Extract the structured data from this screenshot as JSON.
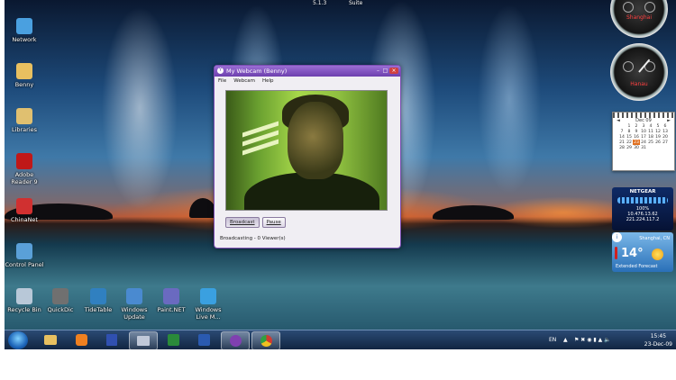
{
  "top_labels": [
    "5.1.3",
    "Suite"
  ],
  "desktop_icons": [
    {
      "label": "Network",
      "color": "#4aa0e0",
      "icon": "network-icon"
    },
    {
      "label": "Benny",
      "color": "#e8c060",
      "icon": "user-folder-icon"
    },
    {
      "label": "Libraries",
      "color": "#e0c070",
      "icon": "libraries-icon"
    },
    {
      "label": "Adobe Reader 9",
      "color": "#c01818",
      "icon": "adobe-reader-icon"
    },
    {
      "label": "ChinaNet",
      "color": "#d03030",
      "icon": "chinanet-icon"
    },
    {
      "label": "Control Panel",
      "color": "#5aa0d8",
      "icon": "control-panel-icon"
    },
    {
      "label": "Recycle Bin",
      "color": "#b8c8d8",
      "icon": "recycle-bin-icon"
    },
    {
      "label": "QuickDic",
      "color": "#707070",
      "icon": "quickdic-icon"
    },
    {
      "label": "TideTable",
      "color": "#3080c0",
      "icon": "tidetable-icon"
    },
    {
      "label": "Windows Update",
      "color": "#4a8ad0",
      "icon": "windows-update-icon"
    },
    {
      "label": "Paint.NET",
      "color": "#6a6ac0",
      "icon": "paint-net-icon"
    },
    {
      "label": "Windows Live M...",
      "color": "#3aa0e0",
      "icon": "windows-live-icon"
    }
  ],
  "webcam_window": {
    "title": "My Webcam (Benny)",
    "menu": [
      "File",
      "Webcam",
      "Help"
    ],
    "broadcast_button": "Broadcast",
    "pause_button": "Pause",
    "status": "Broadcasting - 0 Viewer(s)"
  },
  "clocks": [
    {
      "city": "Shanghai"
    },
    {
      "city": "Hanau"
    }
  ],
  "calendar": {
    "month": "Dec 09",
    "weeks": [
      [
        "1",
        "2",
        "3",
        "4",
        "5",
        "6"
      ],
      [
        "7",
        "8",
        "9",
        "10",
        "11",
        "12",
        "13"
      ],
      [
        "14",
        "15",
        "16",
        "17",
        "18",
        "19",
        "20"
      ],
      [
        "21",
        "22",
        "23",
        "24",
        "25",
        "26",
        "27"
      ],
      [
        "28",
        "29",
        "30",
        "31",
        "",
        "",
        ""
      ]
    ],
    "today": "23"
  },
  "netgear": {
    "brand": "NETGEAR",
    "signal": "100%",
    "ip1": "10.476.13.62",
    "ip2": "221.224.117.2"
  },
  "weather": {
    "city": "Shanghai, CN",
    "temp": "14°",
    "footer": "Extended Forecast"
  },
  "tray": {
    "lang": "EN",
    "time": "15:45",
    "date": "23-Dec-09"
  }
}
